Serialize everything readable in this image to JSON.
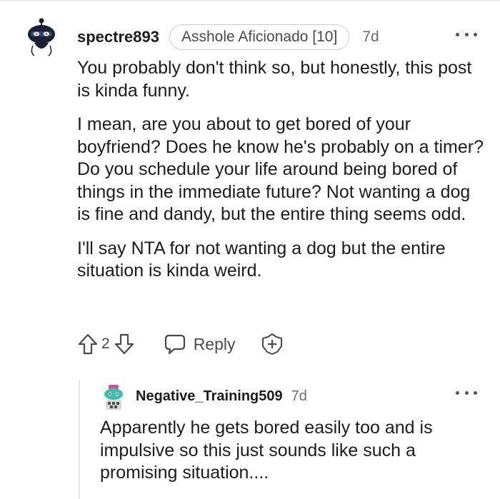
{
  "comment": {
    "username": "spectre893",
    "flair": "Asshole Aficionado [10]",
    "age": "7d",
    "paragraphs": [
      "You probably don't think so, but honestly, this post is kinda funny.",
      "I mean, are you about to get bored of your boyfriend? Does he know he's probably on a timer? Do you schedule your life around being bored of things in the immediate future? Not wanting a dog is fine and dandy, but the entire thing seems odd.",
      "I'll say NTA for not wanting a dog but the entire situation is kinda weird."
    ],
    "vote_count": "2",
    "reply_label": "Reply"
  },
  "reply": {
    "username": "Negative_Training509",
    "age": "7d",
    "text": "Apparently he gets bored easily too and is impulsive so this just sounds like such a promising situation...."
  },
  "icons": {
    "upvote": "upvote-arrow-icon",
    "downvote": "downvote-arrow-icon",
    "reply": "speech-bubble-icon",
    "award": "award-plus-icon",
    "more": "more-options-icon",
    "avatar_main": "snoo-avatar-icon",
    "avatar_reply": "snoo-avatar-icon"
  },
  "colors": {
    "text": "#1c1c1c",
    "meta": "#6b6b6b",
    "icon": "#4a4a4a",
    "divider": "#e6e6e6"
  }
}
